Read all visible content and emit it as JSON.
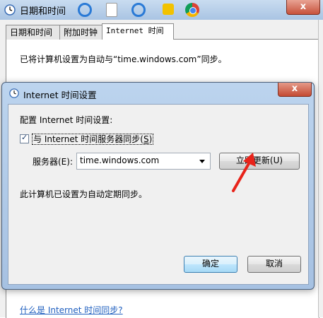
{
  "parent_window": {
    "title": "日期和时间",
    "close_glyph": "x",
    "tabs": [
      {
        "label": "日期和时间"
      },
      {
        "label": "附加时钟"
      },
      {
        "label": "Internet 时间"
      }
    ],
    "sync_status_text": "已将计算机设置为自动与“time.windows.com”同步。",
    "help_link": "什么是 Internet 时间同步?"
  },
  "dialog": {
    "title": "Internet 时间设置",
    "close_glyph": "x",
    "config_label": "配置 Internet 时间设置:",
    "sync_checkbox": {
      "checked": true,
      "label_prefix": "与 Internet 时间服务器同步(",
      "label_hotkey": "S",
      "label_suffix": ")"
    },
    "server_label": "服务器(E):",
    "server_value": "time.windows.com",
    "update_now_label": "立即更新(U)",
    "auto_sync_text": "此计算机已设置为自动定期同步。",
    "ok_label": "确定",
    "cancel_label": "取消"
  },
  "colors": {
    "titlebar": "#a9c4e3",
    "close_button": "#c7523c",
    "link": "#1f5fbf",
    "annotation_arrow": "#e8231a"
  },
  "icons": {
    "parent_title_icon": "clock-icon",
    "dialog_title_icon": "clock-icon",
    "annotation": "red-arrow-icon"
  }
}
